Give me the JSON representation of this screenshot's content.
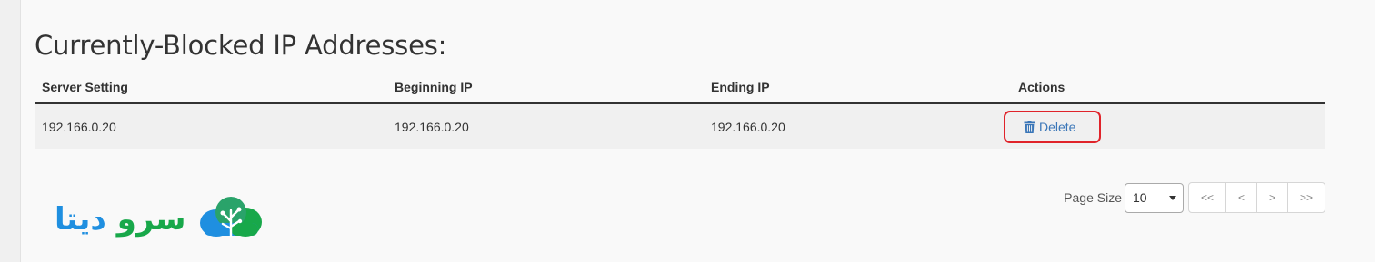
{
  "section": {
    "title": "Currently-Blocked IP Addresses:"
  },
  "table": {
    "headers": [
      "Server Setting",
      "Beginning IP",
      "Ending IP",
      "Actions"
    ],
    "rows": [
      {
        "server_setting": "192.166.0.20",
        "beginning_ip": "192.166.0.20",
        "ending_ip": "192.166.0.20",
        "action_label": "Delete",
        "action_icon": "trash-icon"
      }
    ]
  },
  "logo": {
    "text_blue": "دیتا",
    "text_green": "سرو",
    "icon": "cloud-tree-icon",
    "colors": {
      "blue": "#1f8fe0",
      "green": "#18a84a"
    }
  },
  "pagination": {
    "page_size_label": "Page Size",
    "page_size_value": "10",
    "first_label": "<<",
    "prev_label": "<",
    "next_label": ">",
    "last_label": ">>"
  },
  "colors": {
    "link": "#3a76b8",
    "highlight_border": "#e0232a",
    "row_bg": "#f0f0f0"
  }
}
